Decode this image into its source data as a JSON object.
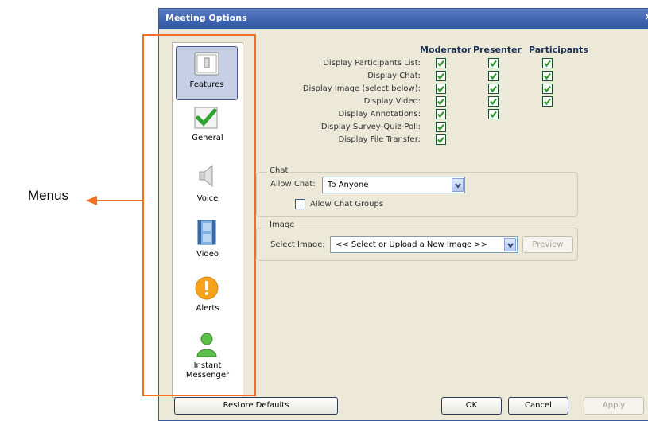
{
  "window": {
    "title": "Meeting Options",
    "close_glyph": "×"
  },
  "nav": {
    "items": [
      {
        "label": "Features",
        "icon": "features-icon"
      },
      {
        "label": "General",
        "icon": "checkmark-icon"
      },
      {
        "label": "Voice",
        "icon": "speaker-icon"
      },
      {
        "label": "Video",
        "icon": "film-icon"
      },
      {
        "label": "Alerts",
        "icon": "alert-icon"
      },
      {
        "label": "Instant",
        "label2": "Messenger",
        "icon": "person-icon"
      }
    ],
    "selected": "Features"
  },
  "features": {
    "columns": [
      "Moderator",
      "Presenter",
      "Participants"
    ],
    "rows": [
      {
        "label": "Display Participants List:",
        "moderator": true,
        "presenter": true,
        "participants": true
      },
      {
        "label": "Display Chat:",
        "moderator": true,
        "presenter": true,
        "participants": true
      },
      {
        "label": "Display Image (select below):",
        "moderator": true,
        "presenter": true,
        "participants": true
      },
      {
        "label": "Display Video:",
        "moderator": true,
        "presenter": true,
        "participants": true
      },
      {
        "label": "Display Annotations:",
        "moderator": true,
        "presenter": true,
        "participants": false
      },
      {
        "label": "Display Survey-Quiz-Poll:",
        "moderator": true,
        "presenter": false,
        "participants": false
      },
      {
        "label": "Display File Transfer:",
        "moderator": true,
        "presenter": false,
        "participants": false
      }
    ]
  },
  "chat": {
    "group_title": "Chat",
    "allow_chat_label": "Allow Chat:",
    "allow_chat_value": "To Anyone",
    "allow_groups_label": "Allow Chat Groups",
    "allow_groups_checked": false
  },
  "image": {
    "group_title": "Image",
    "select_label": "Select Image:",
    "select_value": "<< Select or Upload a New Image >>",
    "preview_label": "Preview"
  },
  "footer": {
    "restore_label": "Restore Defaults",
    "ok_label": "OK",
    "cancel_label": "Cancel",
    "apply_label": "Apply"
  },
  "annotation": {
    "label": "Menus",
    "color": "#f07028"
  },
  "colors": {
    "title_bar": "#3c62ad",
    "dialog_bg": "#ece9d8",
    "check": "#2a9a2a"
  }
}
